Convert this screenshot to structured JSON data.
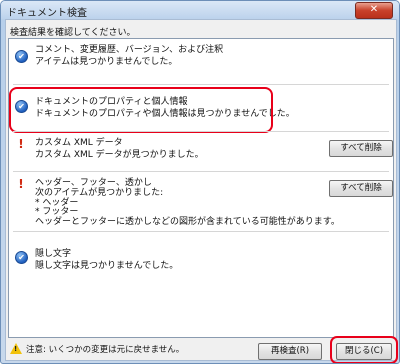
{
  "window": {
    "title": "ドキュメント検査",
    "close_glyph": "✕"
  },
  "instruction": "検査結果を確認してください。",
  "items": [
    {
      "status": "ok",
      "title": "コメント、変更履歴、バージョン、および注釈",
      "description": "アイテムは見つかりませんでした。"
    },
    {
      "status": "ok",
      "title": "ドキュメントのプロパティと個人情報",
      "description": "ドキュメントのプロパティや個人情報は見つかりませんでした。"
    },
    {
      "status": "found",
      "title": "カスタム XML データ",
      "description": "カスタム XML データが見つかりました。",
      "button": "すべて削除"
    },
    {
      "status": "found",
      "title": "ヘッダー、フッター、透かし",
      "description": "次のアイテムが見つかりました:\n* ヘッダー\n* フッター\nヘッダーとフッターに透かしなどの図形が含まれている可能性があります。",
      "button": "すべて削除"
    },
    {
      "status": "ok",
      "title": "隠し文字",
      "description": "隠し文字は見つかりませんでした。"
    }
  ],
  "icons": {
    "ok": "check-circle-icon",
    "found": "exclamation-icon",
    "warning": "warning-triangle-icon"
  },
  "colors": {
    "highlight": "#e8001a",
    "check": "#1f5fbf",
    "found": "#d02a12"
  },
  "footer": {
    "warning_text": "注意: いくつかの変更は元に戻せません。",
    "reinspect_button": "再検査(R)",
    "close_button": "閉じる(C)"
  }
}
